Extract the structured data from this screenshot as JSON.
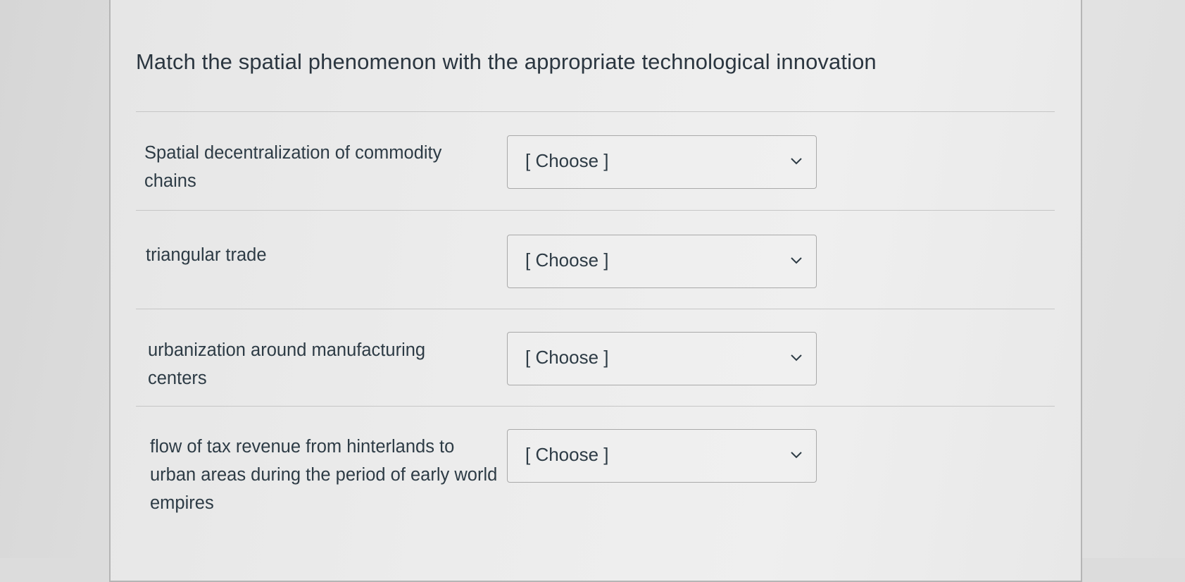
{
  "question": {
    "title": "Match the spatial phenomenon with the appropriate technological innovation"
  },
  "rows": [
    {
      "label": "Spatial decentralization of commodity chains",
      "select_value": "[ Choose ]"
    },
    {
      "label": "triangular trade",
      "select_value": "[ Choose ]"
    },
    {
      "label": "urbanization around manufacturing centers",
      "select_value": "[ Choose ]"
    },
    {
      "label": "flow of tax revenue from hinterlands to urban areas during the period of early world empires",
      "select_value": "[ Choose ]"
    }
  ],
  "icons": {
    "dropdown": "chevron-down-icon"
  }
}
